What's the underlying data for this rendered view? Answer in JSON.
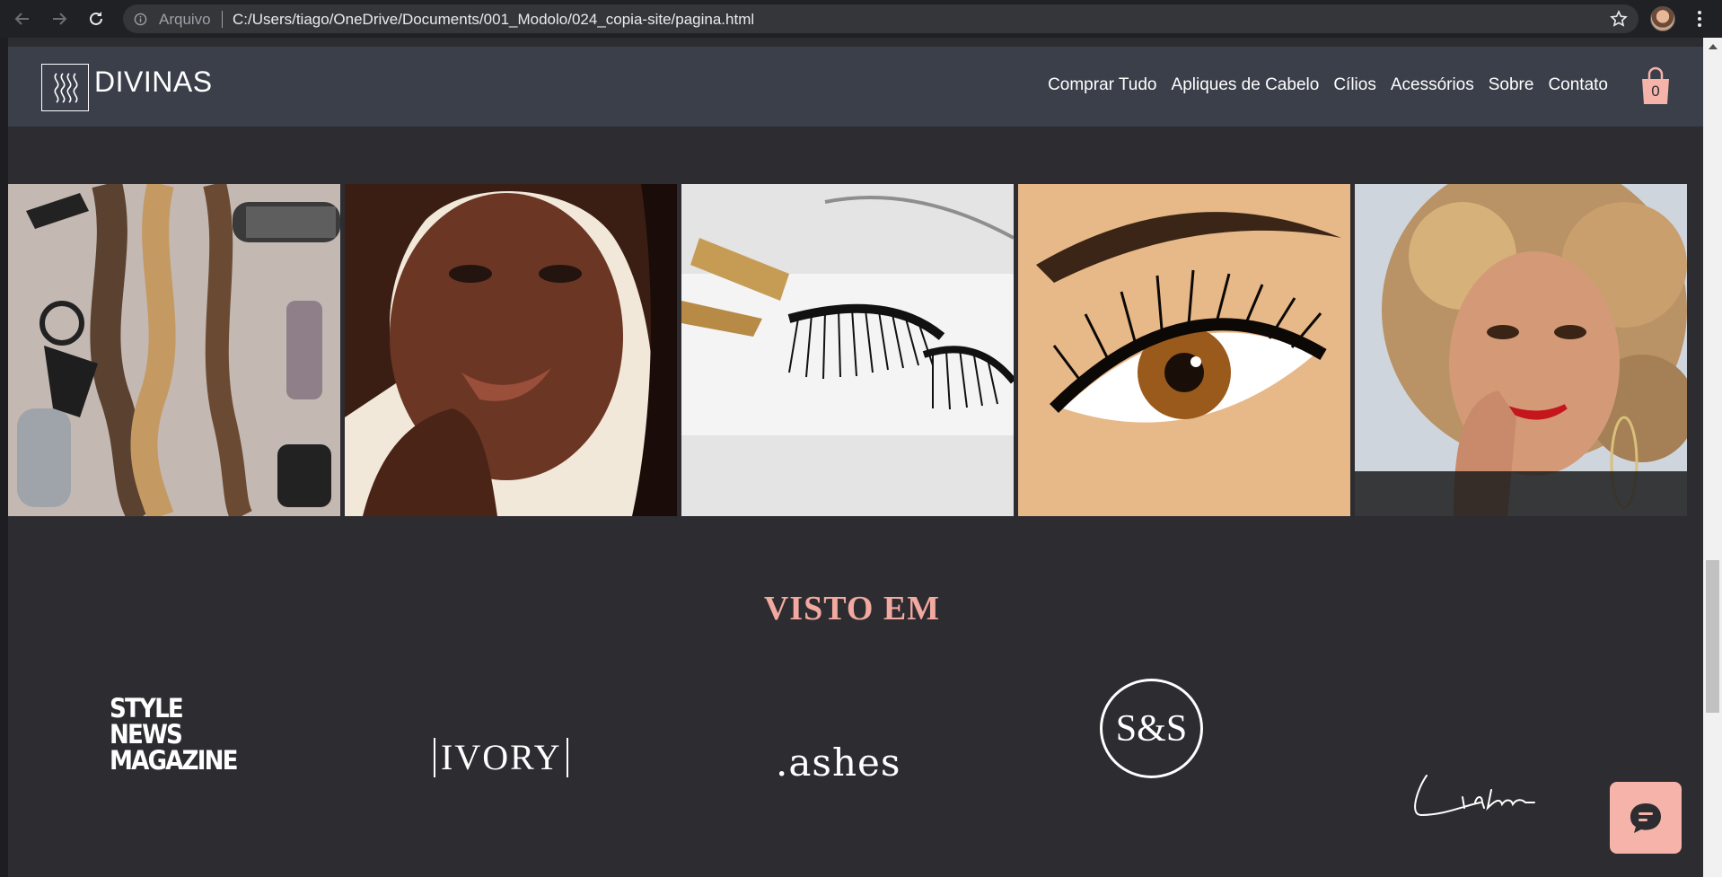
{
  "browser": {
    "address_scheme": "Arquivo",
    "address_url": "C:/Users/tiago/OneDrive/Documents/001_Modolo/024_copia-site/pagina.html"
  },
  "site": {
    "brand": "DIVINAS",
    "nav": [
      {
        "label": "Comprar Tudo"
      },
      {
        "label": "Apliques de Cabelo"
      },
      {
        "label": "Cílios"
      },
      {
        "label": "Acessórios"
      },
      {
        "label": "Sobre"
      },
      {
        "label": "Contato"
      }
    ],
    "cart_count": "0"
  },
  "gallery": {
    "items": [
      {
        "subject": "hair braids and styling tools"
      },
      {
        "subject": "woman portrait with bronze makeup"
      },
      {
        "subject": "false eyelashes with curler"
      },
      {
        "subject": "close-up eye with long lashes"
      },
      {
        "subject": "curly-haired woman portrait"
      }
    ]
  },
  "seen_in": {
    "title": "VISTO EM",
    "logos": {
      "style_news": [
        "STYLE",
        "NEWS",
        "MAGAZINE"
      ],
      "ivory": "IVORY",
      "lashes": ".ashes",
      "ss": "S&S",
      "linda": "Linda"
    }
  },
  "colors": {
    "page_bg": "#2d2c31",
    "header_bg": "#3a3f4a",
    "accent": "#f5b3a9",
    "title_accent": "#f2a99f"
  },
  "icons": {
    "back": "arrow-left-icon",
    "forward": "arrow-right-icon",
    "reload": "reload-icon",
    "info": "info-icon",
    "star": "star-icon",
    "cart": "shopping-bag-icon",
    "chat": "chat-bubble-icon"
  }
}
